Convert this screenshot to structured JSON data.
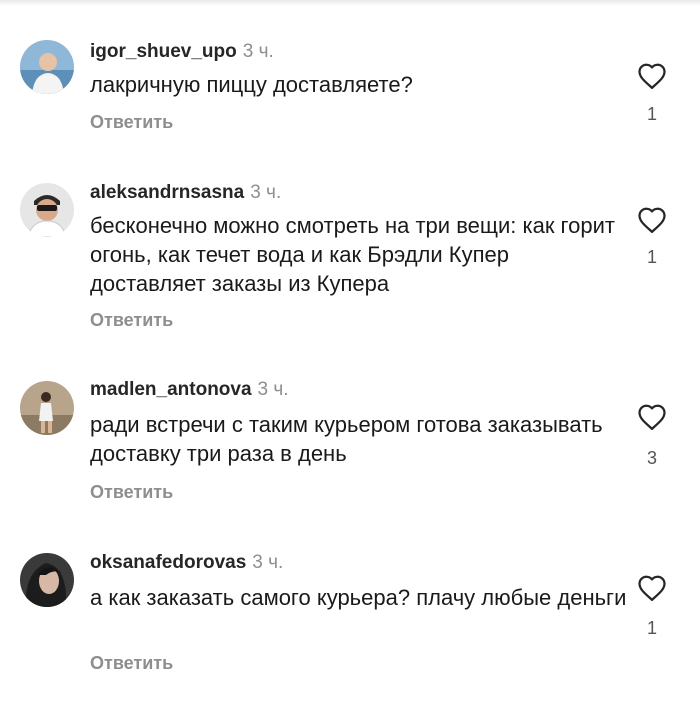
{
  "comments": [
    {
      "username": "igor_shuev_upo",
      "time": "3 ч.",
      "text": "лакричную пиццу доставляете?",
      "reply_label": "Ответить",
      "likes": "1"
    },
    {
      "username": "aleksandrnsasna",
      "time": "3 ч.",
      "text": "бесконечно можно смотреть на три вещи: как горит огонь, как течет вода и как Брэдли Купер доставляет заказы из Купера",
      "reply_label": "Ответить",
      "likes": "1"
    },
    {
      "username": "madlen_antonova",
      "time": "3 ч.",
      "text": "ради встречи с таким курьером готова заказывать доставку три раза в день",
      "reply_label": "Ответить",
      "likes": "3"
    },
    {
      "username": "oksanafedorovas",
      "time": "3 ч.",
      "text": "а как заказать самого курьера? плачу любые деньги",
      "reply_label": "Ответить",
      "likes": "1"
    }
  ],
  "icons": {
    "like": "heart-outline-icon"
  },
  "colors": {
    "username": "#262626",
    "secondary": "#8e8e8e",
    "text": "#1a1a1a"
  }
}
